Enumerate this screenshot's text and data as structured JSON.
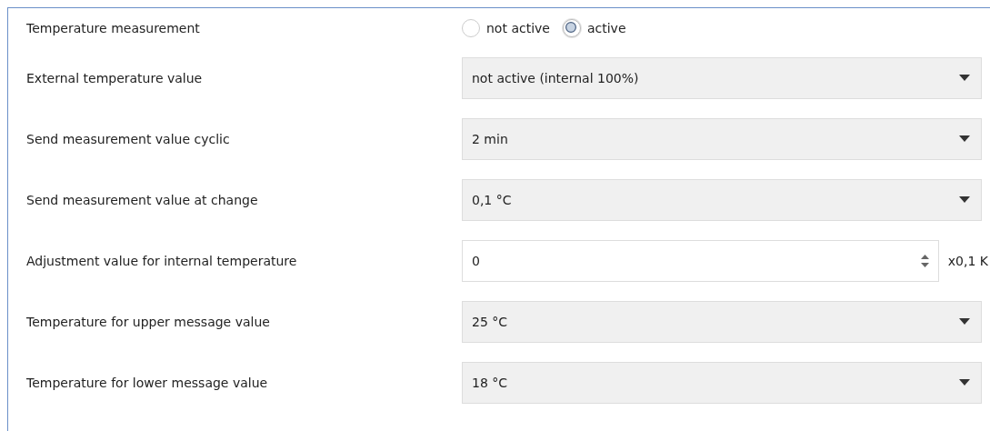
{
  "rows": [
    {
      "kind": "radio",
      "label": "Temperature measurement",
      "options": [
        {
          "label": "not active",
          "selected": false
        },
        {
          "label": "active",
          "selected": true
        }
      ]
    },
    {
      "kind": "dropdown",
      "label": "External temperature value",
      "value": "not active (internal 100%)"
    },
    {
      "kind": "dropdown",
      "label": "Send measurement value cyclic",
      "value": "2 min"
    },
    {
      "kind": "dropdown",
      "label": "Send measurement value at change",
      "value": "0,1 °C"
    },
    {
      "kind": "spinner",
      "label": "Adjustment value for internal temperature",
      "value": "0",
      "unit": "x0,1 K"
    },
    {
      "kind": "dropdown",
      "label": "Temperature for upper message value",
      "value": "25 °C"
    },
    {
      "kind": "dropdown",
      "label": "Temperature for lower message value",
      "value": "18 °C"
    }
  ]
}
